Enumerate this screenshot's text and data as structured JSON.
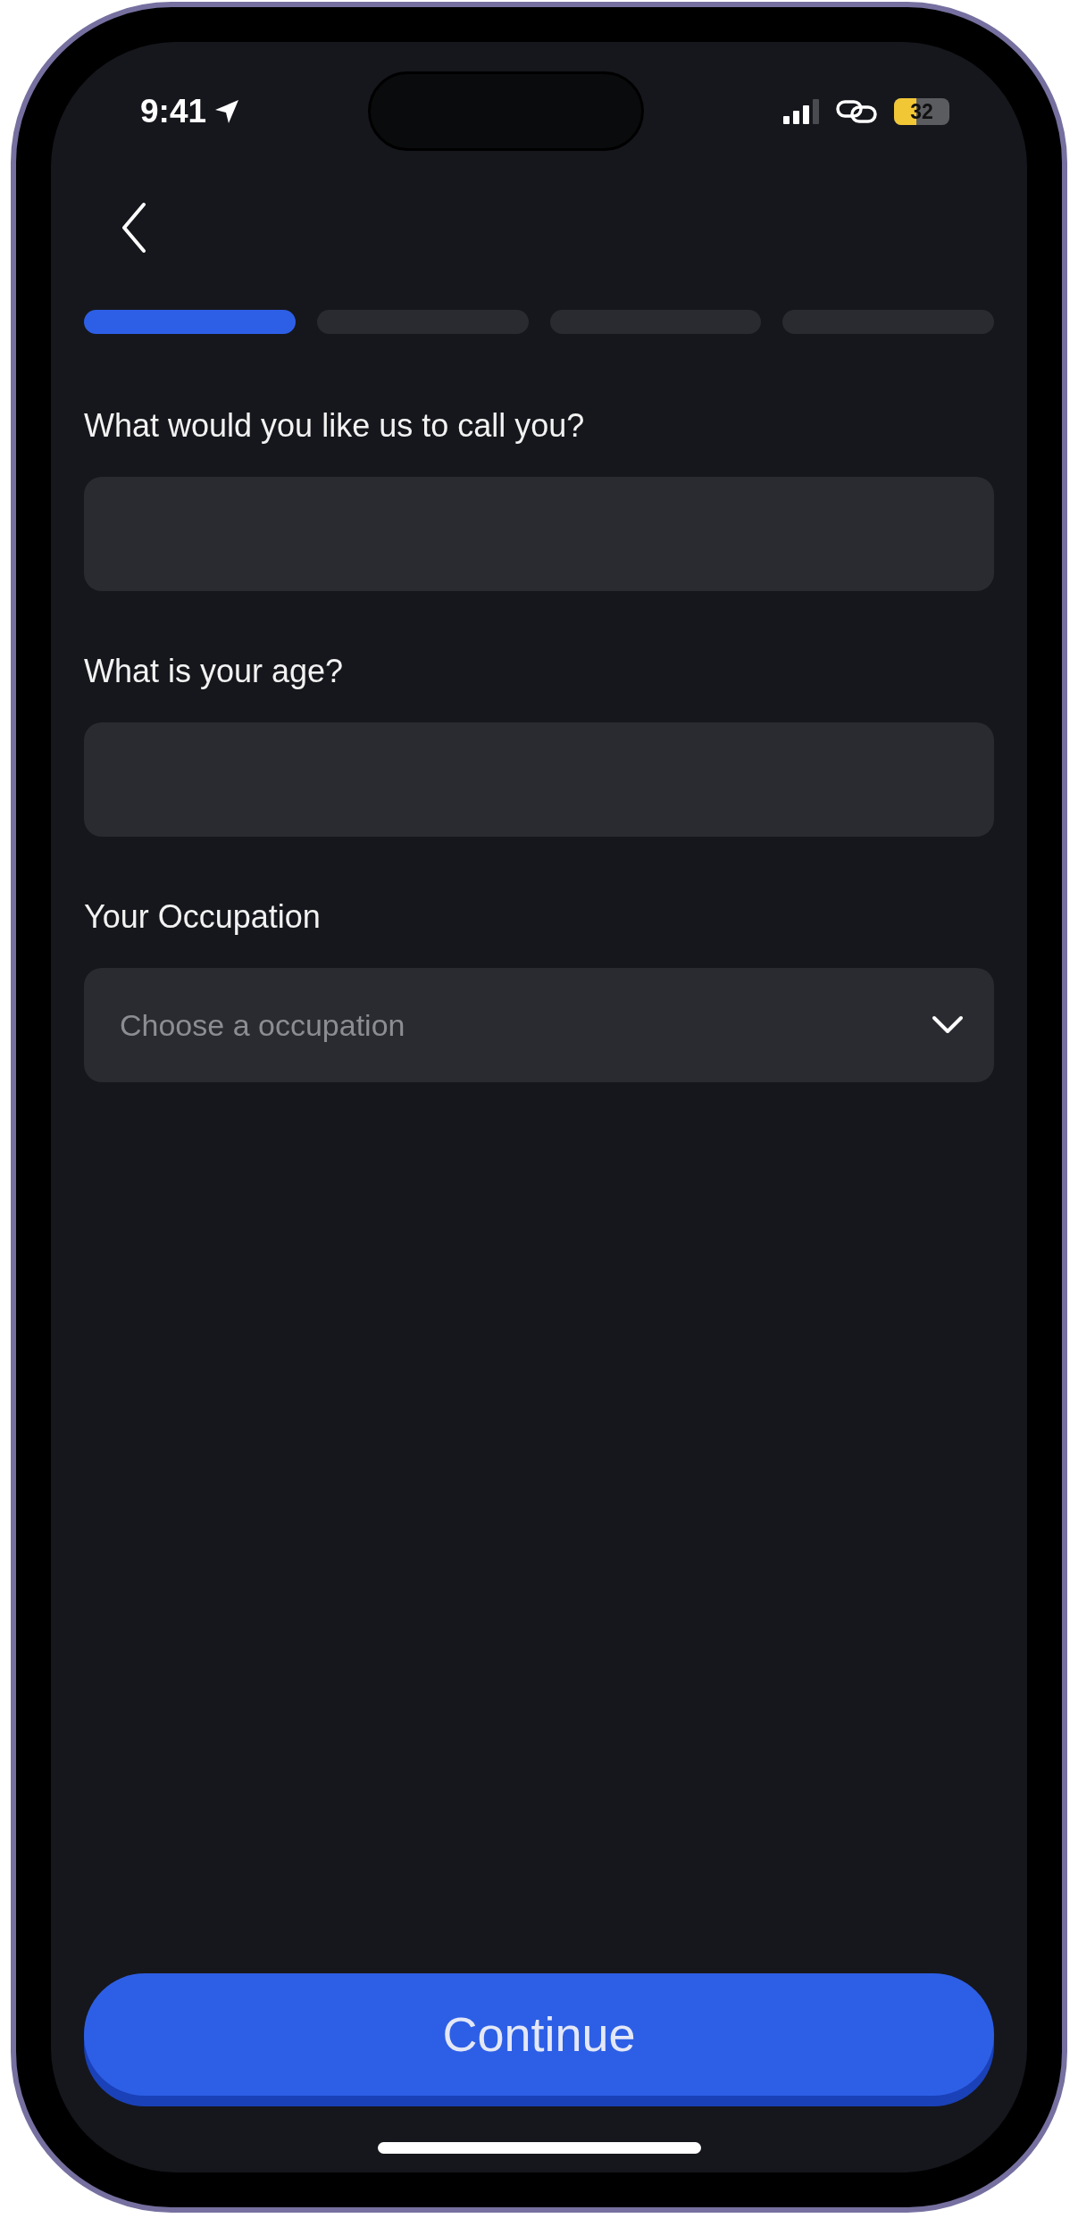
{
  "status_bar": {
    "time": "9:41",
    "battery": "32"
  },
  "progress": [
    {
      "selected": true
    },
    {
      "selected": false
    },
    {
      "selected": false
    },
    {
      "selected": false
    }
  ],
  "fields": [
    {
      "kind": "text",
      "label": "What would you like us to call you?"
    },
    {
      "kind": "text",
      "label": "What is your age?"
    },
    {
      "kind": "select",
      "label": "Your Occupation",
      "placeholder": "Choose a occupation"
    }
  ],
  "button": "Continue"
}
